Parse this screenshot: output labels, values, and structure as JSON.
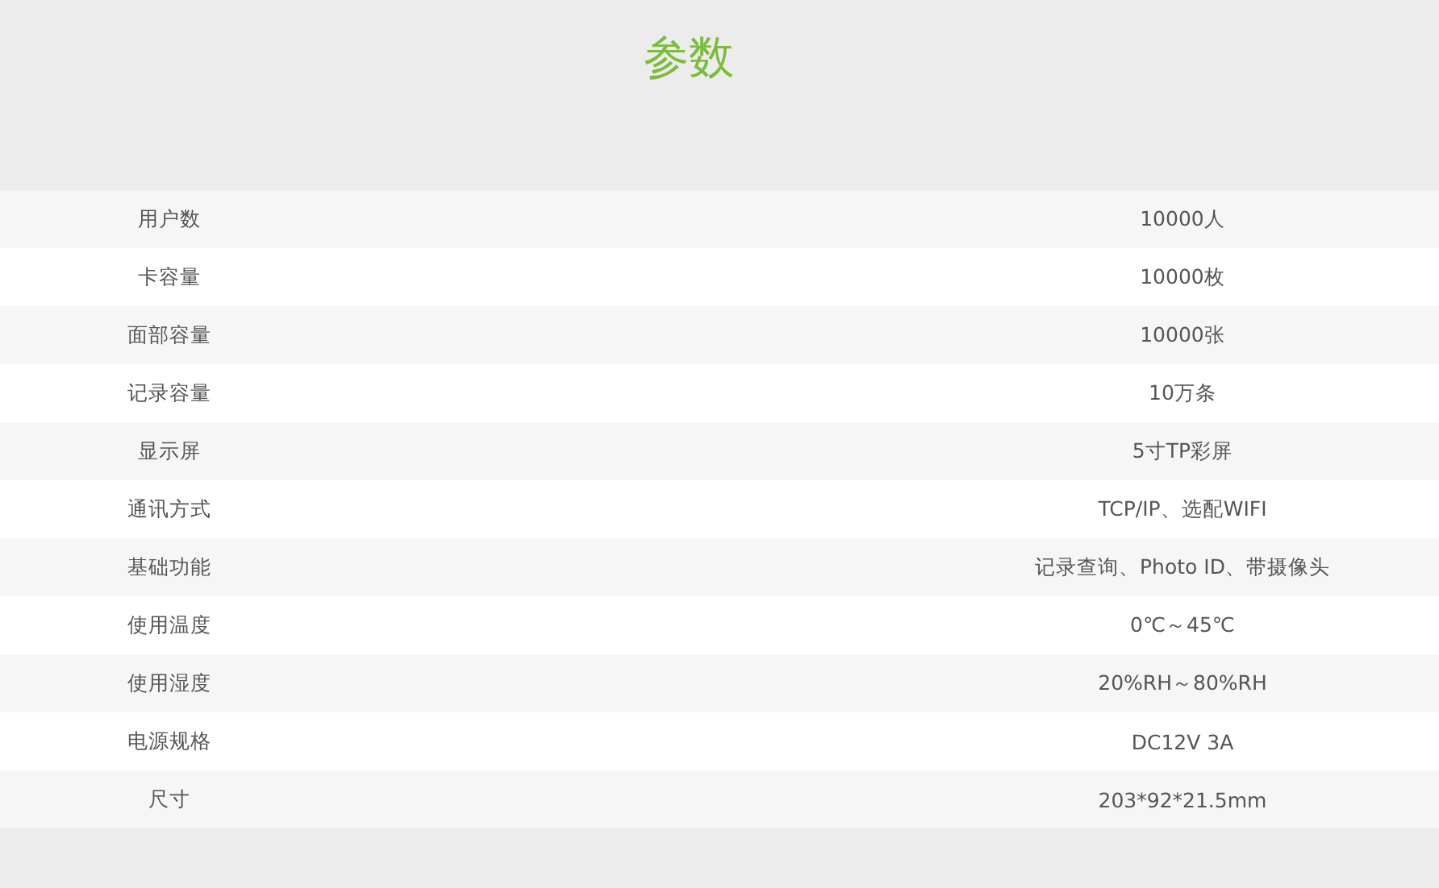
{
  "title": "参数",
  "table": {
    "rows": [
      {
        "label": "用户数",
        "value": "10000人"
      },
      {
        "label": "卡容量",
        "value": "10000枚"
      },
      {
        "label": "面部容量",
        "value": "10000张"
      },
      {
        "label": "记录容量",
        "value": "10万条"
      },
      {
        "label": "显示屏",
        "value": "5寸TP彩屏"
      },
      {
        "label": "通讯方式",
        "value": "TCP/IP、选配WIFI"
      },
      {
        "label": "基础功能",
        "value": "记录查询、Photo ID、带摄像头"
      },
      {
        "label": "使用温度",
        "value": "0℃～45℃"
      },
      {
        "label": "使用湿度",
        "value": "20%RH～80%RH"
      },
      {
        "label": "电源规格",
        "value": "DC12V 3A"
      },
      {
        "label": "尺寸",
        "value": "203*92*21.5mm"
      }
    ]
  }
}
